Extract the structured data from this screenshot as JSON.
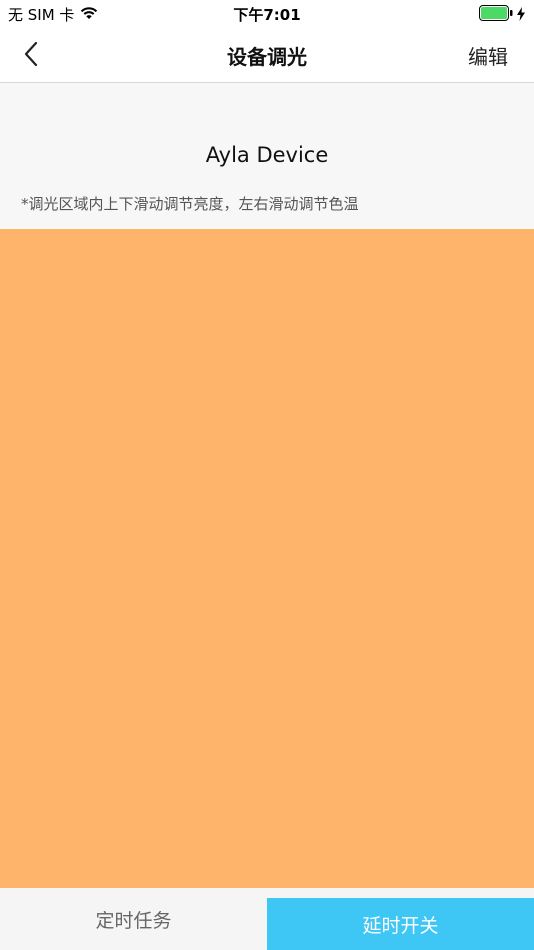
{
  "status_bar": {
    "carrier": "无 SIM 卡",
    "time": "下午7:01",
    "battery_color": "#4cd964"
  },
  "nav": {
    "title": "设备调光",
    "edit_label": "编辑"
  },
  "device": {
    "name": "Ayla Device",
    "hint": "*调光区域内上下滑动调节亮度，左右滑动调节色温"
  },
  "dimmer": {
    "color": "#ffb46b"
  },
  "bottom": {
    "timer_label": "定时任务",
    "delay_label": "延时开关",
    "delay_color": "#3ec6f5"
  },
  "icons": {
    "back": "chevron-left-icon",
    "wifi": "wifi-icon",
    "battery": "battery-icon",
    "charging": "bolt-icon"
  }
}
